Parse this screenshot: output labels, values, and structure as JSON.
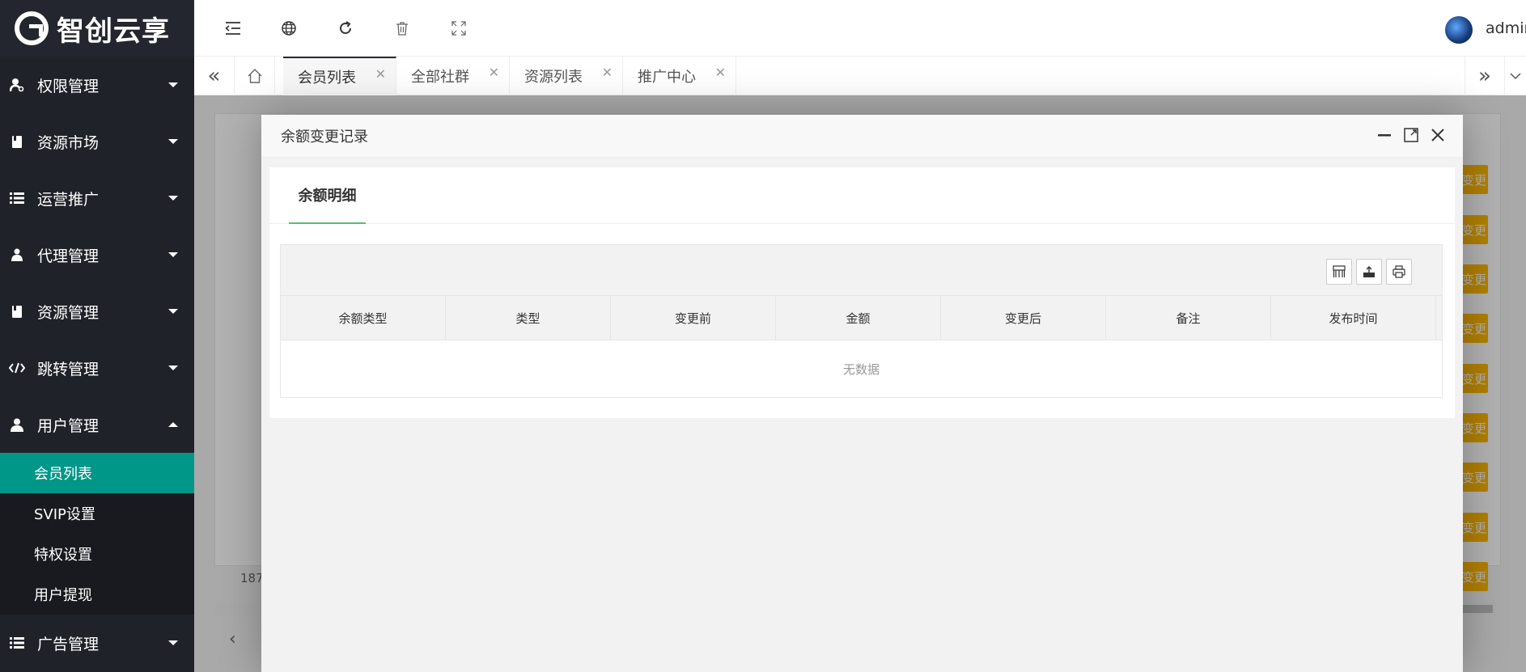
{
  "app": {
    "logo_text": "智创云享"
  },
  "sidebar": {
    "items": [
      {
        "label": "权限管理",
        "icon": "key-user-icon"
      },
      {
        "label": "资源市场",
        "icon": "book-icon"
      },
      {
        "label": "运营推广",
        "icon": "list-icon"
      },
      {
        "label": "代理管理",
        "icon": "users-icon"
      },
      {
        "label": "资源管理",
        "icon": "book-icon"
      },
      {
        "label": "跳转管理",
        "icon": "code-icon"
      },
      {
        "label": "用户管理",
        "icon": "user-icon"
      }
    ],
    "submenu": [
      {
        "label": "会员列表",
        "active": true
      },
      {
        "label": "SVIP设置"
      },
      {
        "label": "特权设置"
      },
      {
        "label": "用户提现"
      }
    ],
    "after": {
      "label": "广告管理",
      "icon": "list-icon"
    }
  },
  "header": {
    "username": "admin"
  },
  "tabs": [
    {
      "label": "会员列表",
      "active": true
    },
    {
      "label": "全部社群"
    },
    {
      "label": "资源列表"
    },
    {
      "label": "推广中心"
    }
  ],
  "background": {
    "row_button_label": "变更",
    "count_text": "187",
    "accent_color": "#ffb800"
  },
  "modal": {
    "title": "余额变更记录",
    "tab": "余额明细",
    "columns": [
      "余额类型",
      "类型",
      "变更前",
      "金额",
      "变更后",
      "备注",
      "发布时间"
    ],
    "empty_text": "无数据"
  },
  "colors": {
    "sidebar_bg": "#20222a",
    "active_item": "#009688",
    "tab_underline": "#5fb878"
  }
}
